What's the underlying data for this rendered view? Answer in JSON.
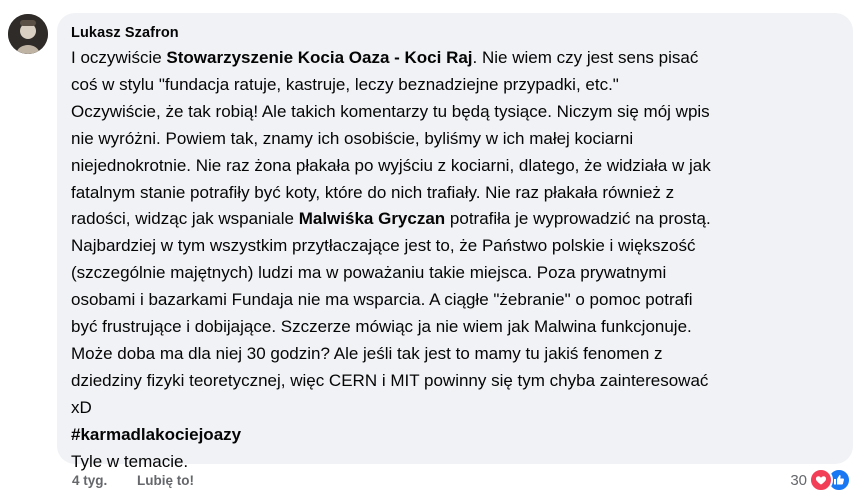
{
  "comment": {
    "author": "Lukasz Szafron",
    "segments": [
      {
        "text": "I oczywiście "
      },
      {
        "text": "Stowarzyszenie Kocia Oaza - Koci Raj",
        "bold": true
      },
      {
        "text": ". Nie wiem czy jest sens pisać"
      },
      {
        "text": "coś w stylu \"fundacja ratuje, kastruje, leczy beznadziejne przypadki, etc.\""
      },
      {
        "text": "Oczywiście, że tak robią! Ale takich komentarzy tu będą tysiące. Niczym się mój wpis"
      },
      {
        "text": "nie wyróżni. Powiem tak, znamy ich osobiście, byliśmy w ich małej kociarni"
      },
      {
        "text": "niejednokrotnie. Nie raz żona płakała po wyjściu z kociarni, dlatego, że widziała w jak"
      },
      {
        "text": "fatalnym stanie potrafiły być koty, które do nich trafiały. Nie raz płakała również z"
      },
      {
        "text": "radości, widząc jak wspaniale "
      },
      {
        "text": "Malwiśka Gryczan",
        "bold": true
      },
      {
        "text": " potrafiła je wyprowadzić na prostą."
      },
      {
        "text": "Najbardziej w tym wszystkim przytłaczające jest to, że Państwo polskie i większość"
      },
      {
        "text": "(szczególnie majętnych) ludzi ma w poważaniu takie miejsca. Poza prywatnymi"
      },
      {
        "text": "osobami i bazarkami Fundaja nie ma wsparcia. A ciągłe \"żebranie\" o pomoc potrafi"
      },
      {
        "text": "być frustrujące i dobijające. Szczerze mówiąc ja nie wiem jak Malwina funkcjonuje."
      },
      {
        "text": "Może doba ma dla niej 30 godzin? Ale jeśli tak jest to mamy tu jakiś fenomen z"
      },
      {
        "text": "dziedziny fizyki teoretycznej, więc CERN i MIT powinny się tym chyba zainteresować"
      },
      {
        "text": "xD"
      }
    ],
    "hashtag": "#karmadlakociejoazy",
    "closing": "Tyle w temacie."
  },
  "footer": {
    "time": "4 tyg.",
    "like_label": "Lubię to!",
    "reaction_count": "30",
    "reaction_icons": [
      "heart-icon",
      "thumbs-up-icon"
    ]
  },
  "colors": {
    "bubble": "#f0f2f5",
    "text": "#050505",
    "meta": "#65676b",
    "love": "#f33e58",
    "like": "#1877f2"
  }
}
